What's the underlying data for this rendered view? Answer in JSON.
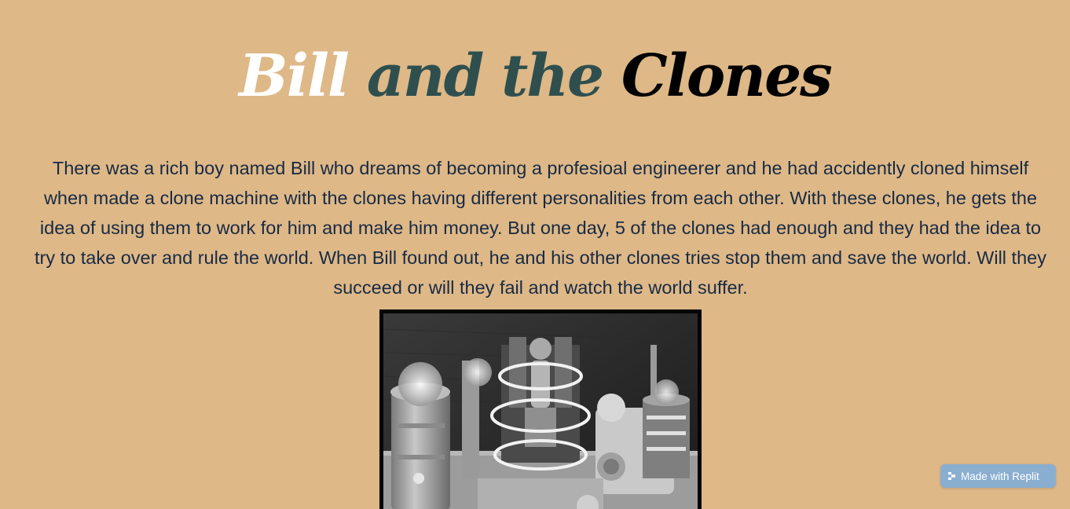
{
  "title": {
    "part1": "Bill",
    "part2": "and the",
    "part3": "Clones"
  },
  "story": "There was a rich boy named Bill who dreams of becoming a profesioal engineerer and he had accidently cloned himself when made a clone machine with the clones having different personalities from each other. With these clones, he gets the idea of using them to work for him and make him money. But one day, 5 of the clones had enough and they had the idea to try to take over and rule the world. When Bill found out, he and his other clones tries stop them and save the world. Will they succeed or will they fail and watch the world suffer.",
  "badge": {
    "label": "Made with Replit",
    "icon": "replit-logo-icon"
  },
  "colors": {
    "background": "#DEB887",
    "title_part1": "#FFFFFF",
    "title_part2": "#2F4F4F",
    "title_part3": "#000000",
    "story_text": "#172A45",
    "badge_background": "#8AAED0"
  }
}
